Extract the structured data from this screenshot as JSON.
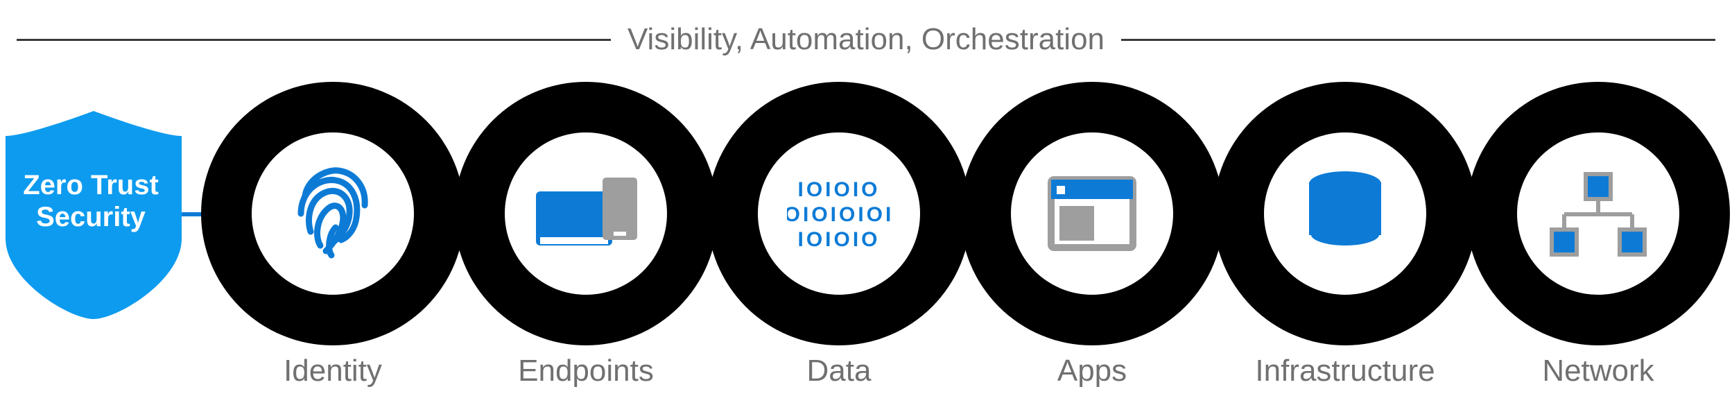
{
  "header_title": "Visibility, Automation, Orchestration",
  "shield_label": "Zero Trust Security",
  "pillars": [
    {
      "label": "Identity",
      "icon": "fingerprint-icon"
    },
    {
      "label": "Endpoints",
      "icon": "devices-icon"
    },
    {
      "label": "Data",
      "icon": "binary-icon"
    },
    {
      "label": "Apps",
      "icon": "window-icon"
    },
    {
      "label": "Infrastructure",
      "icon": "database-icon"
    },
    {
      "label": "Network",
      "icon": "network-icon"
    }
  ],
  "colors": {
    "accent_blue": "#0d7bd6",
    "ring_black": "#000000",
    "grey_text": "#707070",
    "icon_grey": "#9e9e9e"
  }
}
